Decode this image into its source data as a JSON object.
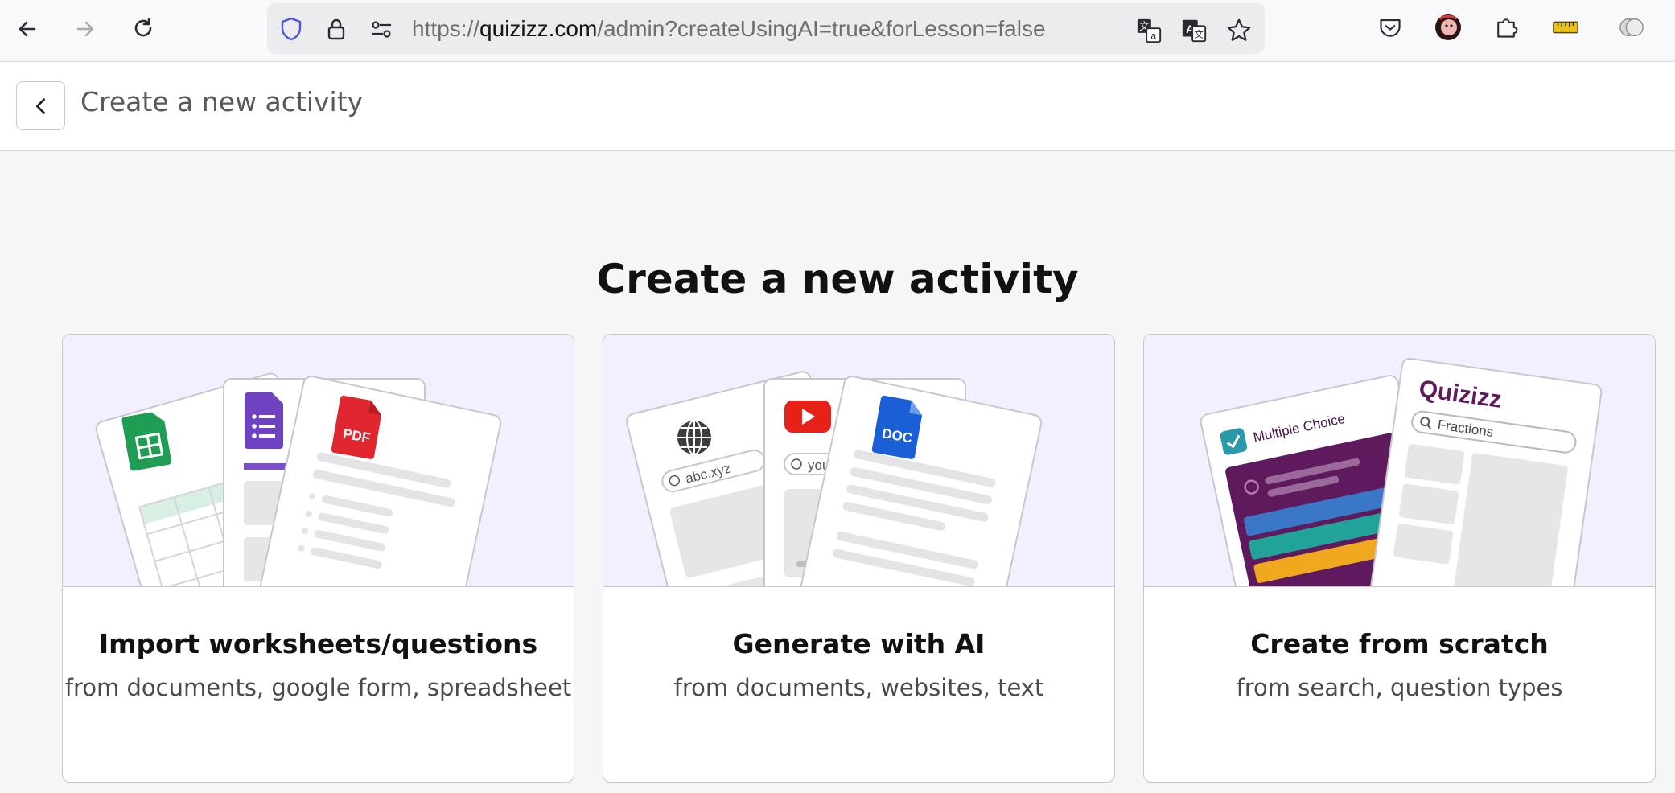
{
  "browser": {
    "url_prefix": "https://",
    "url_host": "quizizz.com",
    "url_path": "/admin?createUsingAI=true&forLesson=false"
  },
  "header": {
    "title": "Create a new activity"
  },
  "main": {
    "title": "Create a new activity",
    "cards": [
      {
        "title": "Import worksheets/questions",
        "subtitle": "from documents, google form, spreadsheet",
        "badge": "PDF"
      },
      {
        "title": "Generate with AI",
        "subtitle": "from documents, websites, text",
        "url_a": "abc.xyz",
        "url_b": "youtub",
        "badge": "DOC"
      },
      {
        "title": "Create from scratch",
        "subtitle": "from search, question types",
        "tag": "Multiple Choice",
        "brand": "Quizizz",
        "search": "Fractions"
      }
    ]
  },
  "icons": {
    "back": "arrow-left-icon",
    "forward": "arrow-right-icon",
    "reload": "reload-icon",
    "shield": "shield-icon",
    "lock": "lock-icon",
    "permissions": "sliders-icon",
    "translate": "translate-icon",
    "reader": "translate-alt-icon",
    "bookmark": "star-icon",
    "pocket": "pocket-icon",
    "profile": "avatar",
    "extensions": "puzzle-icon",
    "ruler": "ruler-icon",
    "account": "account-icon"
  },
  "colors": {
    "accent": "#8854c0",
    "illustration_bg": "#f3efff"
  }
}
